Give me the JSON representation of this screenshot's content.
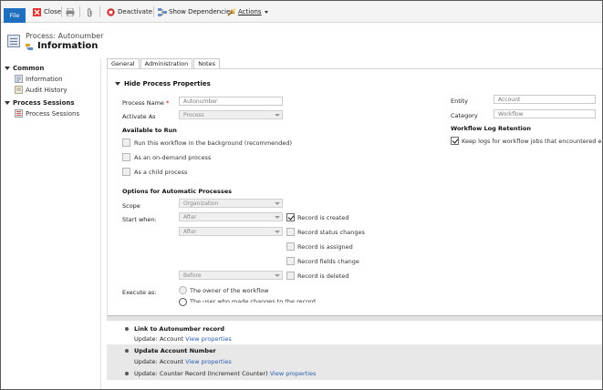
{
  "ribbon": {
    "file": "File",
    "close": "Close",
    "deactivate": "Deactivate",
    "show_dependencies": "Show Dependencies",
    "actions": "Actions"
  },
  "header": {
    "subtitle": "Process: Autonumber",
    "title": "Information"
  },
  "nav": {
    "common_heading": "Common",
    "common_items": [
      "Information",
      "Audit History"
    ],
    "sessions_heading": "Process Sessions",
    "sessions_items": [
      "Process Sessions"
    ]
  },
  "tabs": [
    "General",
    "Administration",
    "Notes"
  ],
  "section": {
    "title": "Hide Process Properties",
    "process_name_label": "Process Name",
    "required_mark": "*",
    "process_name_value": "Autonumber",
    "activate_as_label": "Activate As",
    "activate_as_value": "Process",
    "entity_label": "Entity",
    "entity_value": "Account",
    "category_label": "Category",
    "category_value": "Workflow",
    "retention_heading": "Workflow Log Retention",
    "retention_option": "Keep logs for workflow jobs that encountered errors",
    "available_heading": "Available to Run",
    "available_options": [
      "Run this workflow in the background (recommended)",
      "As an on-demand process",
      "As a child process"
    ],
    "automatic_heading": "Options for Automatic Processes",
    "scope_label": "Scope",
    "scope_value": "Organization",
    "start_when_label": "Start when:",
    "start_selects": [
      "After",
      "After",
      "Before"
    ],
    "triggers": [
      "Record is created",
      "Record status changes",
      "Record is assigned",
      "Record fields change",
      "Record is deleted"
    ],
    "execute_as_label": "Execute as:",
    "execute_options": [
      "The owner of the workflow",
      "The user who made changes to the record"
    ]
  },
  "steps": [
    {
      "title": "Link to Autonumber record",
      "update_label": "Update:",
      "entity": "Account",
      "link": "View properties"
    },
    {
      "title": "Update Account Number",
      "update_label": "Update:",
      "entity": "Account",
      "link": "View properties"
    },
    {
      "title": "",
      "update_label": "Update:",
      "entity": "Counter Record (Increment Counter)",
      "link": "View properties"
    }
  ],
  "colors": {
    "file_tab": "#1e6fc0",
    "link": "#2a5db0",
    "required": "#cc0000"
  }
}
